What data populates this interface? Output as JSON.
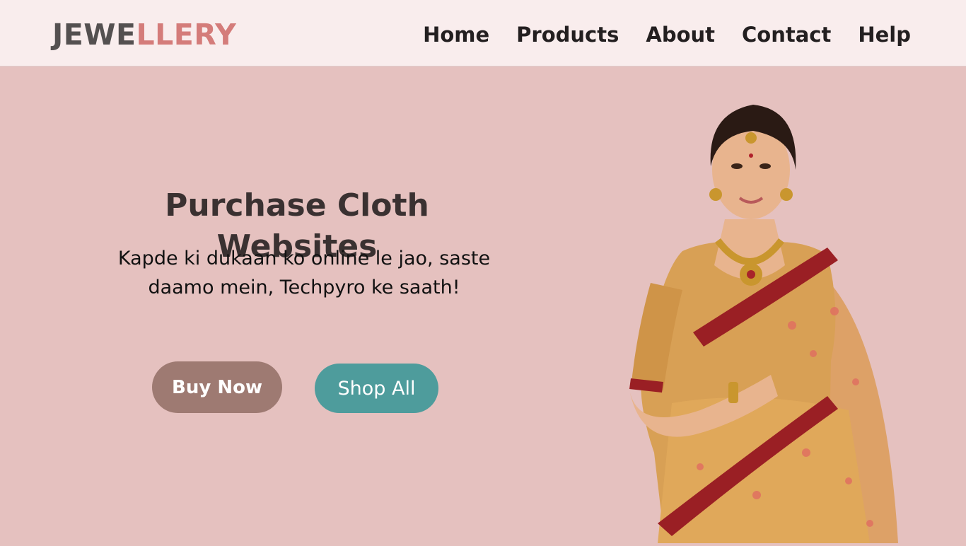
{
  "header": {
    "logo_part1": "JEWE",
    "logo_part2": "LLERY",
    "nav": [
      "Home",
      "Products",
      "About",
      "Contact",
      "Help"
    ]
  },
  "hero": {
    "title": "Purchase Cloth Websites",
    "subtitle": "Kapde ki dukaan ko online le jao, saste daamo mein, Techpyro ke saath!",
    "buy_label": "Buy Now",
    "shop_label": "Shop All",
    "image_desc": "woman-in-saree-with-jewellery"
  },
  "colors": {
    "background": "#e5c1bf",
    "header_bg": "#f9eded",
    "logo_dark": "#545050",
    "logo_accent": "#d47c7a",
    "buy_button": "#9e7a72",
    "shop_button": "#4e9c9c"
  }
}
